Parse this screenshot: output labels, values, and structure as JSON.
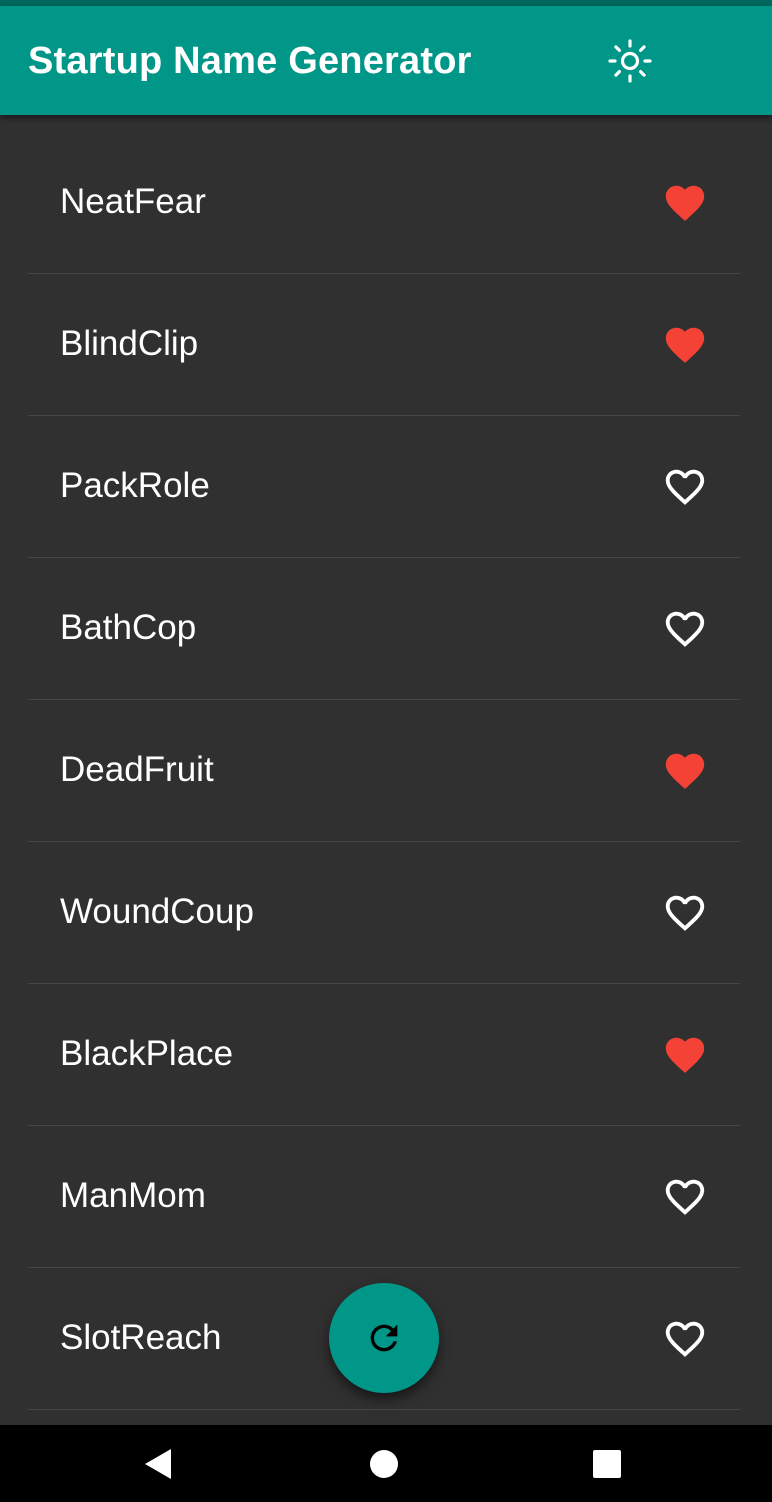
{
  "app_bar": {
    "title": "Startup Name Generator",
    "actions": [
      {
        "icon": "brightness-icon"
      },
      {
        "icon": "list-icon"
      }
    ]
  },
  "colors": {
    "primary": "#009688",
    "primary_dark": "#00695c",
    "background": "#303030",
    "divider": "#464646",
    "favorite": "#f44336",
    "text": "#ffffff"
  },
  "names": [
    {
      "label": "NeatFear",
      "favorite": true
    },
    {
      "label": "BlindClip",
      "favorite": true
    },
    {
      "label": "PackRole",
      "favorite": false
    },
    {
      "label": "BathCop",
      "favorite": false
    },
    {
      "label": "DeadFruit",
      "favorite": true
    },
    {
      "label": "WoundCoup",
      "favorite": false
    },
    {
      "label": "BlackPlace",
      "favorite": true
    },
    {
      "label": "ManMom",
      "favorite": false
    },
    {
      "label": "SlotReach",
      "favorite": false
    }
  ],
  "fab": {
    "icon": "refresh-icon"
  },
  "nav_bar": {
    "buttons": [
      {
        "icon": "back-icon"
      },
      {
        "icon": "home-icon"
      },
      {
        "icon": "recents-icon"
      }
    ]
  }
}
